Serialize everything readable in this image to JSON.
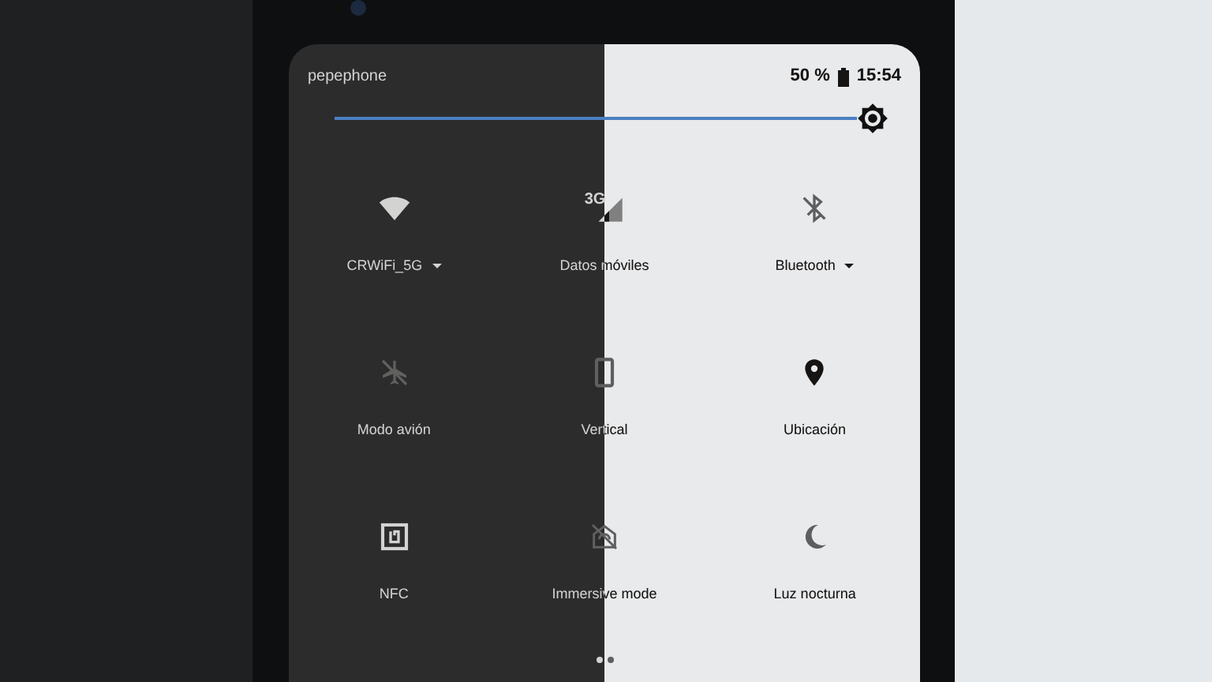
{
  "status_bar": {
    "carrier": "pepephone",
    "battery": "50 %",
    "time": "15:54"
  },
  "brightness": {
    "level": 1
  },
  "tiles": [
    {
      "label": "CRWiFi_5G",
      "on": true,
      "dropdown": true
    },
    {
      "label": "Datos móviles",
      "badge": "3G",
      "on": true,
      "dropdown": false
    },
    {
      "label": "Bluetooth",
      "on": false,
      "dropdown": true
    },
    {
      "label": "Modo avión",
      "on": false,
      "dropdown": false
    },
    {
      "label": "Vertical",
      "on": false,
      "dropdown": false
    },
    {
      "label": "Ubicación",
      "on": true,
      "dropdown": false
    },
    {
      "label": "NFC",
      "on": true,
      "dropdown": false
    },
    {
      "label": "Immersive mode",
      "on": false,
      "dropdown": false
    },
    {
      "label": "Luz nocturna",
      "on": false,
      "dropdown": false
    }
  ],
  "pages": [
    {
      "selected": true
    },
    {
      "selected": false
    }
  ]
}
